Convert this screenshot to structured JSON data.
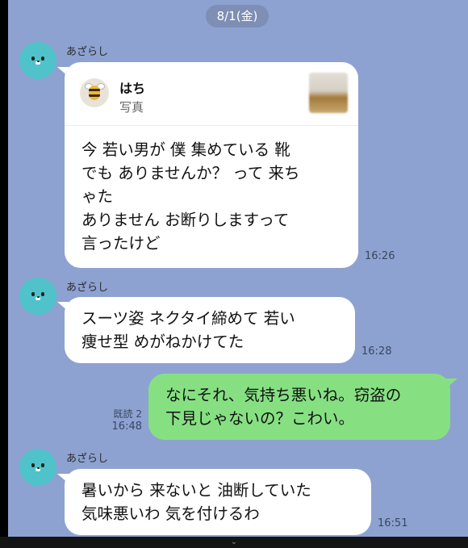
{
  "date_label": "8/1(金)",
  "messages": [
    {
      "sender": "あざらし",
      "share": {
        "title": "はち",
        "subtitle": "写真"
      },
      "text": "今 若い男が 僕 集めている 靴\nでも ありませんか？ って 来ち\nゃた\nありません お断りしますって\n言ったけど",
      "time": "16:26"
    },
    {
      "sender": "あざらし",
      "text": "スーツ姿 ネクタイ締めて 若い\n痩せ型 めがねかけてた",
      "time": "16:28"
    },
    {
      "text": "なにそれ、気持ち悪いね。窃盗の\n下見じゃないの？こわい。",
      "read": "既読 2",
      "time": "16:48"
    },
    {
      "sender": "あざらし",
      "text": "暑いから 来ないと 油断していた\n気味悪いわ 気を付けるわ",
      "time": "16:51"
    }
  ],
  "colors": {
    "chat_bg": "#8DA2D1",
    "outgoing_bubble": "#86E082",
    "incoming_bubble": "#FFFFFF",
    "avatar": "#4FC3C9"
  },
  "icons": [
    "seal-avatar-icon",
    "bee-icon",
    "chevron-down-icon"
  ]
}
